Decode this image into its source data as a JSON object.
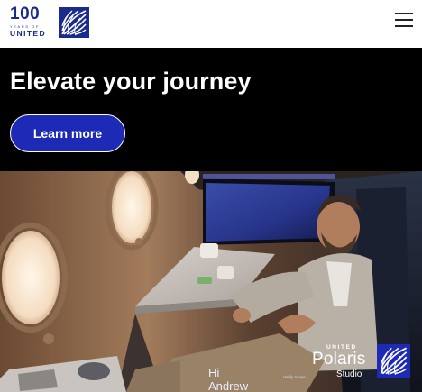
{
  "header": {
    "logo": {
      "number": "100",
      "years_text": "YEARS OF",
      "brand": "UNITED",
      "icon": "globe-icon"
    },
    "menu_icon": "hamburger-menu-icon"
  },
  "hero": {
    "title": "Elevate your journey",
    "cta_label": "Learn more"
  },
  "photo": {
    "screen_greeting": "Hi\nAndrew",
    "screen_subtext": "Verify to see",
    "badge": {
      "brand": "UNITED",
      "name": "Polaris",
      "sub": "Studio",
      "icon": "globe-icon"
    }
  },
  "colors": {
    "brand_blue": "#1a2b8f",
    "cta_blue": "#1d2ab5",
    "hero_bg": "#000000"
  }
}
